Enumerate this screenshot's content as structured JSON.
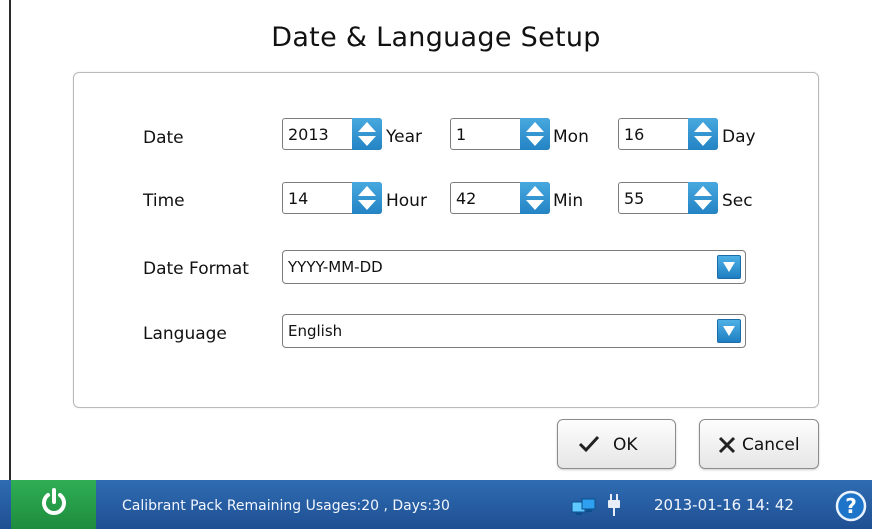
{
  "title": "Date & Language Setup",
  "date_row": {
    "label": "Date",
    "year_value": "2013",
    "year_unit": "Year",
    "month_value": "1",
    "month_unit": "Mon",
    "day_value": "16",
    "day_unit": "Day"
  },
  "time_row": {
    "label": "Time",
    "hour_value": "14",
    "hour_unit": "Hour",
    "min_value": "42",
    "min_unit": "Min",
    "sec_value": "55",
    "sec_unit": "Sec"
  },
  "date_format": {
    "label": "Date Format",
    "value": "YYYY-MM-DD"
  },
  "language": {
    "label": "Language",
    "value": "English"
  },
  "buttons": {
    "ok_label": "OK",
    "cancel_label": "Cancel"
  },
  "status_bar": {
    "message": "Calibrant Pack Remaining Usages:20 , Days:30",
    "datetime": "2013-01-16  14: 42",
    "icons": [
      "power-icon",
      "network-icon",
      "plug-icon",
      "help-icon"
    ]
  },
  "colors": {
    "accent_blue": "#2383c4",
    "status_bar": "#2f6cb2",
    "power_green": "#2fae55"
  }
}
